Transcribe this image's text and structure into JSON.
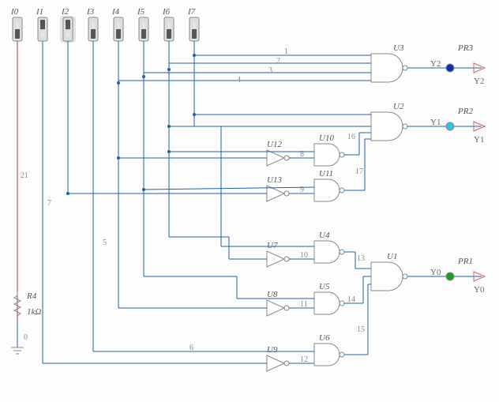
{
  "inputs": [
    {
      "name": "I0",
      "state": "1"
    },
    {
      "name": "I1",
      "state": "0"
    },
    {
      "name": "I2",
      "state": "0"
    },
    {
      "name": "I3",
      "state": "1"
    },
    {
      "name": "I4",
      "state": "1"
    },
    {
      "name": "I5",
      "state": "1"
    },
    {
      "name": "I6",
      "state": "1"
    },
    {
      "name": "I7",
      "state": "1"
    }
  ],
  "gates": {
    "nand4_top": "U3",
    "nand4_mid": "U2",
    "nand2_mid_a": "U10",
    "nand2_mid_b": "U11",
    "inv_mid_a": "U12",
    "inv_mid_b": "U13",
    "nand2_b1": "U4",
    "nand2_b2": "U5",
    "nand2_b3": "U6",
    "inv_b1": "U7",
    "inv_b2": "U8",
    "inv_b3": "U9",
    "nand4_bot": "U1"
  },
  "probes": {
    "p3": {
      "name": "PR3",
      "out": "Y2",
      "pin": "Y2",
      "color": "#1030a8"
    },
    "p2": {
      "name": "PR2",
      "out": "Y1",
      "pin": "Y1",
      "color": "#33c0e8"
    },
    "p1": {
      "name": "PR1",
      "out": "Y0",
      "pin": "Y0",
      "color": "#18a018"
    }
  },
  "resistor": {
    "name": "R4",
    "value": "1kΩ"
  },
  "nets": {
    "n1": "1",
    "n2": "2",
    "n3": "3",
    "n4": "4",
    "n5": "5",
    "n6": "6",
    "n7": "7",
    "n8": "8",
    "n9": "9",
    "n10": "10",
    "n11": "11",
    "n12": "12",
    "n13": "13",
    "n14": "14",
    "n15": "15",
    "n16": "16",
    "n17": "17",
    "n21": "21",
    "n0": "0"
  }
}
